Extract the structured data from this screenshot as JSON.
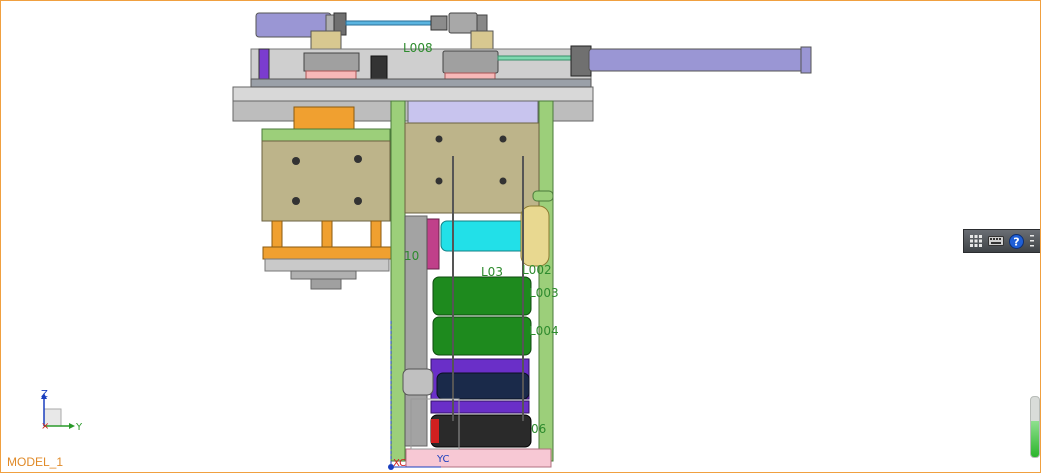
{
  "viewport": {
    "model_name": "MODEL_1",
    "border_color": "#f0a040"
  },
  "part_labels": {
    "l008": "L008",
    "l002": "L002",
    "l003": "L003",
    "l004": "L004",
    "l003_partial": "L03",
    "l001_partial": "10",
    "l006_partial": "06"
  },
  "axis_triad": {
    "z": "Z",
    "y": "Y"
  },
  "work_csys": {
    "xc": "XC",
    "yc": "YC"
  },
  "mini_toolbar": {
    "icons": [
      "grid-icon",
      "keyboard-icon",
      "help-icon",
      "more-icon"
    ]
  },
  "gauge": {
    "level_fraction": 0.6
  },
  "colors": {
    "label_green": "#2e8b2e",
    "accent_orange": "#e08a28",
    "cylinder_purple": "#9a96d4",
    "frame_green": "#9ccf7a",
    "roller_green": "#1e8a1e",
    "cyan_roller": "#22e0e8"
  }
}
